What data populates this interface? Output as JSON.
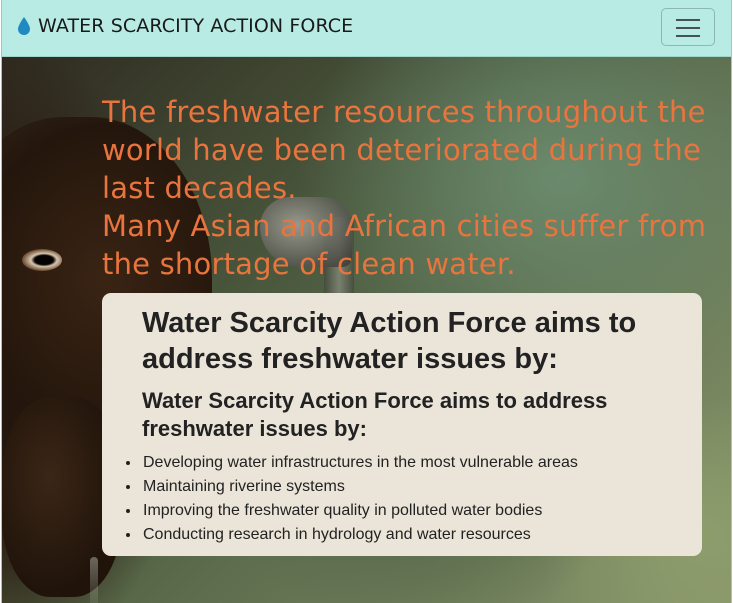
{
  "navbar": {
    "brand_icon": "water-drop-icon",
    "brand_icon_color": "#1f8ac0",
    "brand_text": "WATER SCARCITY ACTION FORCE",
    "toggler_icon": "hamburger-menu-icon",
    "background_color": "#b7ebe3"
  },
  "hero": {
    "headline_lines": [
      "The freshwater resources throughout the world have been deteriorated during the last decades.",
      "Many Asian and African cities suffer from the shortage of clean water."
    ],
    "headline_color": "#e9743e"
  },
  "card": {
    "title": "Water Scarcity Action Force aims to address freshwater issues by:",
    "subtitle": "Water Scarcity Action Force aims to address freshwater issues by:",
    "items": [
      "Developing water infrastructures in the most vulnerable areas",
      "Maintaining riverine systems",
      "Improving the freshwater quality in polluted water bodies",
      "Conducting research in hydrology and water resources"
    ],
    "background_color": "#ebe5d9"
  }
}
